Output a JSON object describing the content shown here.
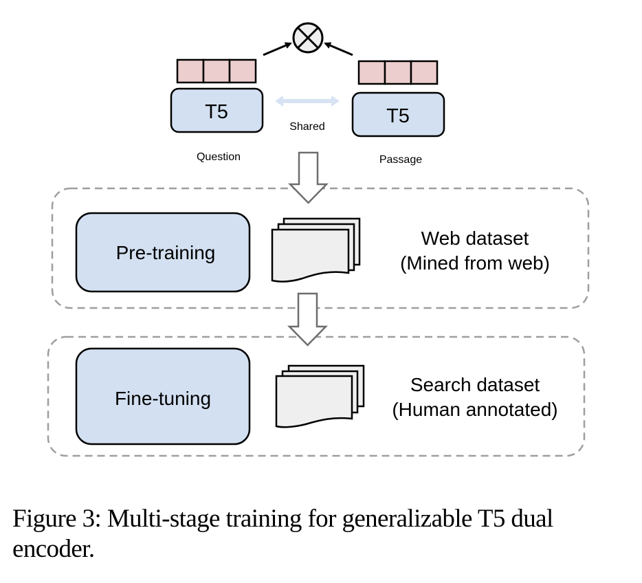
{
  "figure": {
    "encoders": [
      {
        "label": "T5",
        "input_label": "Question"
      },
      {
        "label": "T5",
        "input_label": "Passage"
      }
    ],
    "shared_label": "Shared",
    "similarity_operator": "circled-times",
    "stages": [
      {
        "label": "Pre-training",
        "dataset_title": "Web dataset",
        "dataset_subtitle": "(Mined from web)"
      },
      {
        "label": "Fine-tuning",
        "dataset_title": "Search dataset",
        "dataset_subtitle": "(Human annotated)"
      }
    ],
    "colors": {
      "encoder_fill": "#d3e0f1",
      "vector_fill": "#eccece",
      "shared_arrow": "#d7e3f2",
      "document_fill": "#efefef",
      "dashed_border": "#9e9e9e",
      "flow_arrow": "#6d6d6d",
      "operator_fill": "#efefef"
    }
  },
  "caption": {
    "text": "Figure 3: Multi-stage training for generalizable T5 dual encoder."
  }
}
